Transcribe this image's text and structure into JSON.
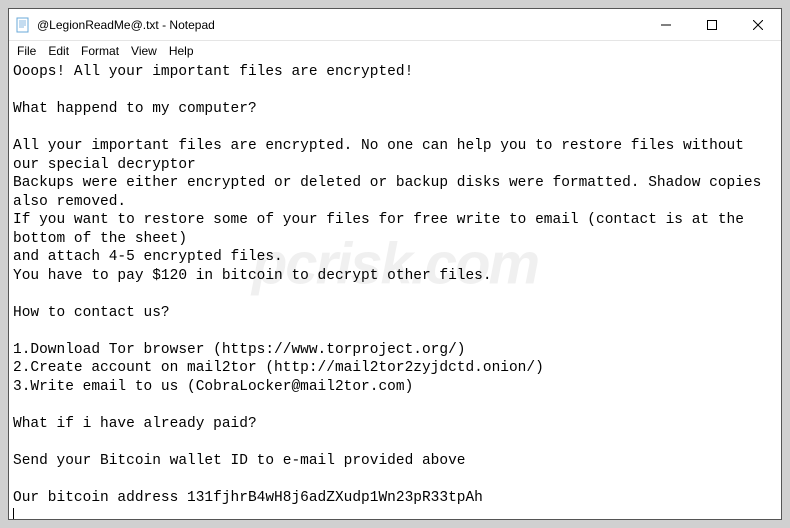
{
  "window": {
    "title": "@LegionReadMe@.txt - Notepad",
    "controls": {
      "minimize": "minimize",
      "maximize": "maximize",
      "close": "close"
    }
  },
  "menubar": {
    "items": [
      "File",
      "Edit",
      "Format",
      "View",
      "Help"
    ]
  },
  "editor": {
    "content": "Ooops! All your important files are encrypted!\n\nWhat happend to my computer?\n\nAll your important files are encrypted. No one can help you to restore files without our special decryptor\nBackups were either encrypted or deleted or backup disks were formatted. Shadow copies also removed.\nIf you want to restore some of your files for free write to email (contact is at the bottom of the sheet)\nand attach 4-5 encrypted files.\nYou have to pay $120 in bitcoin to decrypt other files.\n\nHow to contact us?\n\n1.Download Tor browser (https://www.torproject.org/)\n2.Create account on mail2tor (http://mail2tor2zyjdctd.onion/)\n3.Write email to us (CobraLocker@mail2tor.com)\n\nWhat if i have already paid?\n\nSend your Bitcoin wallet ID to e-mail provided above\n\nOur bitcoin address 131fjhrB4wH8j6adZXudp1Wn23pR33tpAh"
  },
  "watermark": "pcrisk.com"
}
